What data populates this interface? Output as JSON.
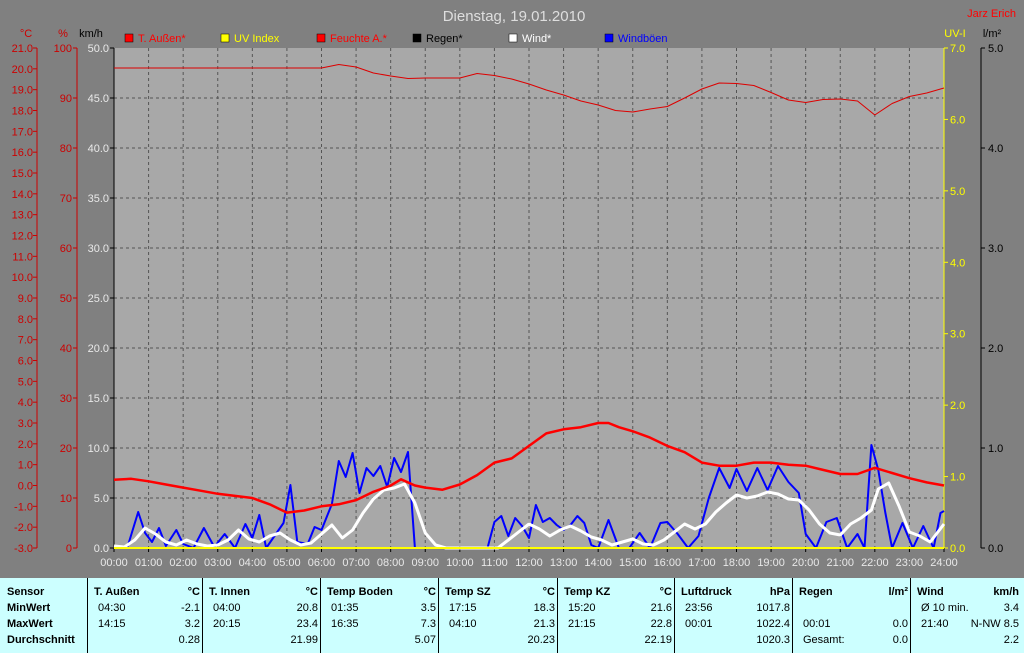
{
  "title": "Dienstag, 19.01.2010",
  "author": "Jarz Erich",
  "colors": {
    "background": "#808080",
    "plot": "#a8a8a8",
    "temperature": "#ff0000",
    "humidity": "#dd0000",
    "uv": "#ffff00",
    "rain": "#000000",
    "wind": "#ffffff",
    "gusts": "#0000ff",
    "axis_red": "#cc0000",
    "axis_uv": "#ffff00",
    "axis_black": "#000000",
    "stats_bg": "#ccffff"
  },
  "axes": {
    "temp_unit": "°C",
    "hum_unit": "%",
    "wind_unit": "km/h",
    "uv_unit": "UV-I",
    "rain_unit": "l/m²",
    "temp_ticks": [
      "21.0",
      "20.0",
      "19.0",
      "18.0",
      "17.0",
      "16.0",
      "15.0",
      "14.0",
      "13.0",
      "12.0",
      "11.0",
      "10.0",
      "9.0",
      "8.0",
      "7.0",
      "6.0",
      "5.0",
      "4.0",
      "3.0",
      "2.0",
      "1.0",
      "0.0",
      "-1.0",
      "-2.0",
      "-3.0"
    ],
    "hum_ticks": [
      "100",
      "90",
      "80",
      "70",
      "60",
      "50",
      "40",
      "30",
      "20",
      "10",
      "0"
    ],
    "wind_ticks": [
      "50.0",
      "45.0",
      "40.0",
      "35.0",
      "30.0",
      "25.0",
      "20.0",
      "15.0",
      "10.0",
      "5.0",
      "0.0"
    ],
    "uv_ticks": [
      "7.0",
      "6.0",
      "5.0",
      "4.0",
      "3.0",
      "2.0",
      "1.0",
      "0.0"
    ],
    "rain_ticks": [
      "5.0",
      "4.0",
      "3.0",
      "2.0",
      "1.0",
      "0.0"
    ],
    "time_ticks": [
      "00:00",
      "01:00",
      "02:00",
      "03:00",
      "04:00",
      "05:00",
      "06:00",
      "07:00",
      "08:00",
      "09:00",
      "10:00",
      "11:00",
      "12:00",
      "13:00",
      "14:00",
      "15:00",
      "16:00",
      "17:00",
      "18:00",
      "19:00",
      "20:00",
      "21:00",
      "22:00",
      "23:00",
      "24:00"
    ]
  },
  "legend": [
    {
      "label": "T. Außen*",
      "color": "#ff0000"
    },
    {
      "label": "UV Index",
      "color": "#ffff00"
    },
    {
      "label": "Feuchte A.*",
      "color": "#ff0000"
    },
    {
      "label": "Regen*",
      "color": "#000000"
    },
    {
      "label": "Wind*",
      "color": "#ffffff"
    },
    {
      "label": "Windböen",
      "color": "#0000ff"
    }
  ],
  "chart_data": {
    "type": "line",
    "title": "Dienstag, 19.01.2010",
    "xlabel": "",
    "ylabel": "",
    "xlim": [
      0,
      24
    ],
    "temp_ylim": [
      -3,
      21
    ],
    "hum_ylim": [
      0,
      100
    ],
    "wind_ylim": [
      0,
      50
    ],
    "uv_ylim": [
      0,
      7
    ],
    "rain_ylim": [
      0,
      5
    ],
    "grid": true,
    "legend_position": "top",
    "series": [
      {
        "name": "T. Außen*",
        "axis": "temp",
        "x": [
          0,
          0.5,
          1,
          1.5,
          2,
          2.5,
          3,
          3.5,
          4,
          4.5,
          5,
          5.5,
          6,
          6.5,
          7,
          7.5,
          8,
          8.3,
          8.7,
          9,
          9.5,
          10,
          10.5,
          11,
          11.5,
          12,
          12.5,
          13,
          13.5,
          14,
          14.3,
          14.6,
          15,
          15.5,
          16,
          16.5,
          17,
          17.5,
          18,
          18.5,
          19,
          19.5,
          20,
          20.5,
          21,
          21.5,
          22,
          22.5,
          23,
          23.5,
          24
        ],
        "y": [
          0.28,
          0.32,
          0.2,
          0.05,
          -0.1,
          -0.25,
          -0.4,
          -0.5,
          -0.6,
          -0.9,
          -1.3,
          -1.2,
          -1.0,
          -0.9,
          -0.7,
          -0.3,
          0.0,
          0.3,
          0.0,
          -0.1,
          -0.2,
          0.05,
          0.5,
          1.1,
          1.3,
          1.9,
          2.5,
          2.7,
          2.8,
          3.0,
          3.0,
          2.8,
          2.6,
          2.3,
          1.9,
          1.6,
          1.1,
          0.95,
          0.95,
          1.1,
          1.1,
          1.0,
          0.95,
          0.75,
          0.55,
          0.55,
          0.85,
          0.6,
          0.35,
          0.15,
          0.0
        ]
      },
      {
        "name": "Feuchte A.*",
        "axis": "hum",
        "x": [
          0,
          1,
          2,
          3,
          4,
          5,
          6,
          6.5,
          7,
          7.5,
          8,
          8.5,
          9,
          9.5,
          10,
          10.5,
          11,
          11.5,
          12,
          12.5,
          13,
          13.5,
          14,
          14.5,
          15,
          15.5,
          16,
          16.5,
          17,
          17.5,
          18,
          18.5,
          19,
          19.5,
          20,
          20.5,
          21,
          21.5,
          22,
          22.5,
          23,
          23.5,
          24
        ],
        "y": [
          96,
          96,
          96,
          96,
          96,
          96,
          96,
          96.7,
          96.2,
          95,
          94.4,
          93.9,
          94,
          94,
          94,
          94.9,
          94.5,
          93.8,
          92.8,
          91.6,
          90.6,
          89.4,
          88.6,
          87.5,
          87.2,
          87.8,
          88.3,
          90,
          91.8,
          93,
          92.9,
          92.5,
          91.1,
          89.6,
          89.1,
          89.7,
          89.8,
          89.4,
          86.6,
          88.9,
          90.3,
          91,
          92
        ]
      },
      {
        "name": "UV Index",
        "axis": "uv",
        "x": [
          0,
          24
        ],
        "y": [
          0,
          0
        ]
      },
      {
        "name": "Regen*",
        "axis": "rain",
        "x": [
          0,
          24
        ],
        "y": [
          0,
          0
        ]
      },
      {
        "name": "Wind*",
        "axis": "wind",
        "x": [
          0,
          0.3,
          0.6,
          0.9,
          1.2,
          1.5,
          1.8,
          2.1,
          2.4,
          2.7,
          3.0,
          3.3,
          3.6,
          3.9,
          4.2,
          4.5,
          4.8,
          5.1,
          5.4,
          5.7,
          6.0,
          6.3,
          6.6,
          6.9,
          7.2,
          7.5,
          7.8,
          8.1,
          8.4,
          8.7,
          9.0,
          9.3,
          9.6,
          9.9,
          10.2,
          10.5,
          10.8,
          11.1,
          11.4,
          11.7,
          12.0,
          12.3,
          12.6,
          12.9,
          13.2,
          13.5,
          13.8,
          14.1,
          14.4,
          14.7,
          15.0,
          15.3,
          15.6,
          15.9,
          16.2,
          16.5,
          16.8,
          17.1,
          17.4,
          17.7,
          18.0,
          18.3,
          18.6,
          18.9,
          19.2,
          19.5,
          19.8,
          20.1,
          20.4,
          20.7,
          21.0,
          21.3,
          21.6,
          21.9,
          22.1,
          22.4,
          22.7,
          23.0,
          23.3,
          23.6,
          24.0
        ],
        "y": [
          0.2,
          0.1,
          0.8,
          2.0,
          1.4,
          0.6,
          0.3,
          0.8,
          0.4,
          0.2,
          0.3,
          0.8,
          1.8,
          0.9,
          0.6,
          1.2,
          1.5,
          0.8,
          0.3,
          0.5,
          1.4,
          2.3,
          1.0,
          1.8,
          3.5,
          4.9,
          5.8,
          6.0,
          6.4,
          4.5,
          1.5,
          0.3,
          0,
          0,
          0,
          0,
          0,
          0,
          0.8,
          1.6,
          2.4,
          1.9,
          1.2,
          1.8,
          2.2,
          1.7,
          1.1,
          0.8,
          0.3,
          0.6,
          0.9,
          0.4,
          0.3,
          0.8,
          1.6,
          2.4,
          1.9,
          2.4,
          3.6,
          4.5,
          5.3,
          5.0,
          5.2,
          5.6,
          5.4,
          4.9,
          4.8,
          3.8,
          2.4,
          1.5,
          1.3,
          2.4,
          3.0,
          3.8,
          5.9,
          6.5,
          4.2,
          1.6,
          1.2,
          0.6,
          2.4
        ]
      },
      {
        "name": "Windböen",
        "axis": "wind",
        "x": [
          0,
          0.4,
          0.7,
          0.9,
          1.1,
          1.3,
          1.5,
          1.8,
          2.0,
          2.3,
          2.6,
          2.9,
          3.2,
          3.5,
          3.8,
          4.0,
          4.2,
          4.4,
          4.6,
          4.9,
          5.1,
          5.3,
          5.6,
          5.8,
          6.0,
          6.3,
          6.5,
          6.7,
          6.9,
          7.1,
          7.3,
          7.5,
          7.7,
          7.9,
          8.1,
          8.3,
          8.5,
          8.7,
          8.9,
          9.1,
          9.4,
          9.7,
          10.0,
          10.4,
          10.8,
          11.0,
          11.2,
          11.4,
          11.6,
          11.8,
          12.0,
          12.2,
          12.4,
          12.6,
          12.8,
          13.0,
          13.2,
          13.4,
          13.6,
          13.8,
          14.0,
          14.3,
          14.6,
          14.9,
          15.2,
          15.5,
          15.8,
          16.0,
          16.3,
          16.6,
          16.9,
          17.2,
          17.5,
          17.8,
          18.0,
          18.3,
          18.6,
          18.9,
          19.2,
          19.5,
          19.8,
          20.0,
          20.3,
          20.6,
          20.9,
          21.2,
          21.5,
          21.7,
          21.9,
          22.1,
          22.3,
          22.5,
          22.8,
          23.1,
          23.4,
          23.7,
          23.9,
          24.0
        ],
        "y": [
          0,
          0.2,
          3.6,
          1.5,
          0.6,
          2.0,
          0.2,
          1.8,
          0.4,
          0,
          2.0,
          0.1,
          1.4,
          0,
          2.4,
          1.0,
          3.3,
          0,
          1.0,
          2.5,
          6.3,
          0.6,
          0.4,
          2.1,
          1.8,
          4.4,
          8.7,
          7.1,
          9.5,
          5.5,
          8.0,
          7.2,
          8.2,
          6.1,
          9.0,
          7.6,
          9.6,
          0,
          0,
          0,
          0,
          0,
          0,
          0,
          0,
          2.6,
          3.2,
          1.2,
          3.0,
          2.2,
          1.0,
          4.3,
          2.6,
          3.0,
          2.3,
          1.8,
          2.3,
          3.2,
          2.5,
          0.3,
          0,
          2.8,
          0,
          0,
          1.5,
          0,
          2.5,
          2.6,
          1.4,
          0,
          1.2,
          5.0,
          8.0,
          6.0,
          7.9,
          5.7,
          8.0,
          5.8,
          8.2,
          6.6,
          5.5,
          1.4,
          0,
          2.6,
          3.0,
          0,
          1.4,
          0,
          10.3,
          7.8,
          3.6,
          0,
          2.5,
          0,
          2.2,
          0,
          3.5,
          3.7
        ]
      }
    ]
  },
  "stats": {
    "row_labels": [
      "Sensor",
      "MinWert",
      "MaxWert",
      "Durchschnitt"
    ],
    "columns": [
      {
        "title": "T. Außen",
        "unit": "°C",
        "min_time": "04:30",
        "min_val": "-2.1",
        "max_time": "14:15",
        "max_val": "3.2",
        "avg": "0.28"
      },
      {
        "title": "T. Innen",
        "unit": "°C",
        "min_time": "04:00",
        "min_val": "20.8",
        "max_time": "20:15",
        "max_val": "23.4",
        "avg": "21.99"
      },
      {
        "title": "Temp Boden",
        "unit": "°C",
        "min_time": "01:35",
        "min_val": "3.5",
        "max_time": "16:35",
        "max_val": "7.3",
        "avg": "5.07"
      },
      {
        "title": "Temp SZ",
        "unit": "°C",
        "min_time": "17:15",
        "min_val": "18.3",
        "max_time": "04:10",
        "max_val": "21.3",
        "avg": "20.23"
      },
      {
        "title": "Temp KZ",
        "unit": "°C",
        "min_time": "15:20",
        "min_val": "21.6",
        "max_time": "21:15",
        "max_val": "22.8",
        "avg": "22.19"
      },
      {
        "title": "Luftdruck",
        "unit": "hPa",
        "min_time": "23:56",
        "min_val": "1017.8",
        "max_time": "00:01",
        "max_val": "1022.4",
        "avg": "1020.3"
      },
      {
        "title": "Regen",
        "unit": "l/m²",
        "min_time": "",
        "min_val": "",
        "max_time": "00:01",
        "max_val": "0.0",
        "avg_label": "Gesamt:",
        "avg": "0.0"
      },
      {
        "title": "Wind",
        "unit": "km/h",
        "min_time": "Ø 10 min.",
        "min_val": "3.4",
        "max_time": "21:40",
        "max_val": "N-NW 8.5",
        "avg": "2.2"
      }
    ]
  }
}
